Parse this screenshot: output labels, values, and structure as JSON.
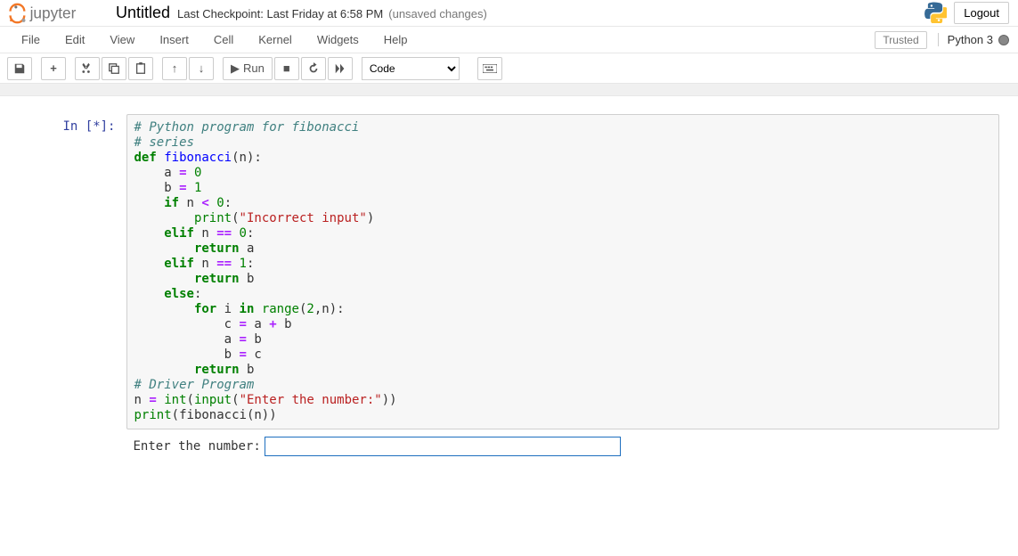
{
  "header": {
    "title": "Untitled",
    "checkpoint": "Last Checkpoint: Last Friday at 6:58 PM",
    "unsaved": "(unsaved changes)",
    "logout": "Logout"
  },
  "menubar": {
    "items": [
      "File",
      "Edit",
      "View",
      "Insert",
      "Cell",
      "Kernel",
      "Widgets",
      "Help"
    ],
    "trusted": "Trusted",
    "kernel": "Python 3"
  },
  "toolbar": {
    "run_label": "Run",
    "cell_type": "Code"
  },
  "cell": {
    "prompt": "In [*]:",
    "code": {
      "l0": "# Python program for fibonacci",
      "l1": "# series",
      "l2": "",
      "l3": "",
      "l4_def": "def",
      "l4_name": " fibonacci",
      "l4_rest": "(n):",
      "l5a": "    a ",
      "l5eq": "=",
      "l5b": " ",
      "l5n": "0",
      "l6a": "    b ",
      "l6eq": "=",
      "l6b": " ",
      "l6n": "1",
      "l7": "",
      "l8if": "    if",
      "l8mid": " n ",
      "l8lt": "<",
      "l8sp": " ",
      "l8n": "0",
      "l8c": ":",
      "l9a": "        ",
      "l9p": "print",
      "l9b": "(",
      "l9s": "\"Incorrect input\"",
      "l9c": ")",
      "l10e": "    elif",
      "l10m": " n ",
      "l10eq": "==",
      "l10sp": " ",
      "l10n": "0",
      "l10c": ":",
      "l11a": "        ",
      "l11r": "return",
      "l11b": " a",
      "l12e": "    elif",
      "l12m": " n ",
      "l12eq": "==",
      "l12sp": " ",
      "l12n": "1",
      "l12c": ":",
      "l13a": "        ",
      "l13r": "return",
      "l13b": " b",
      "l14e": "    else",
      "l14c": ":",
      "l15a": "        ",
      "l15f": "for",
      "l15b": " i ",
      "l15in": "in",
      "l15sp": " ",
      "l15rng": "range",
      "l15args": "(",
      "l15n2": "2",
      "l15cn": ",n):",
      "l16a": "            c ",
      "l16eq": "=",
      "l16b": " a ",
      "l16plus": "+",
      "l16c": " b",
      "l17a": "            a ",
      "l17eq": "=",
      "l17b": " b",
      "l18a": "            b ",
      "l18eq": "=",
      "l18b": " c",
      "l19a": "        ",
      "l19r": "return",
      "l19b": " b",
      "l20": "",
      "l21": "# Driver Program",
      "l22": "",
      "l23a": "n ",
      "l23eq": "=",
      "l23sp": " ",
      "l23int": "int",
      "l23p1": "(",
      "l23inp": "input",
      "l23p2": "(",
      "l23s": "\"Enter the number:\"",
      "l23p3": "))",
      "l24p": "print",
      "l24a": "(fibonacci(n))"
    },
    "stdin_prompt": "Enter the number:"
  }
}
